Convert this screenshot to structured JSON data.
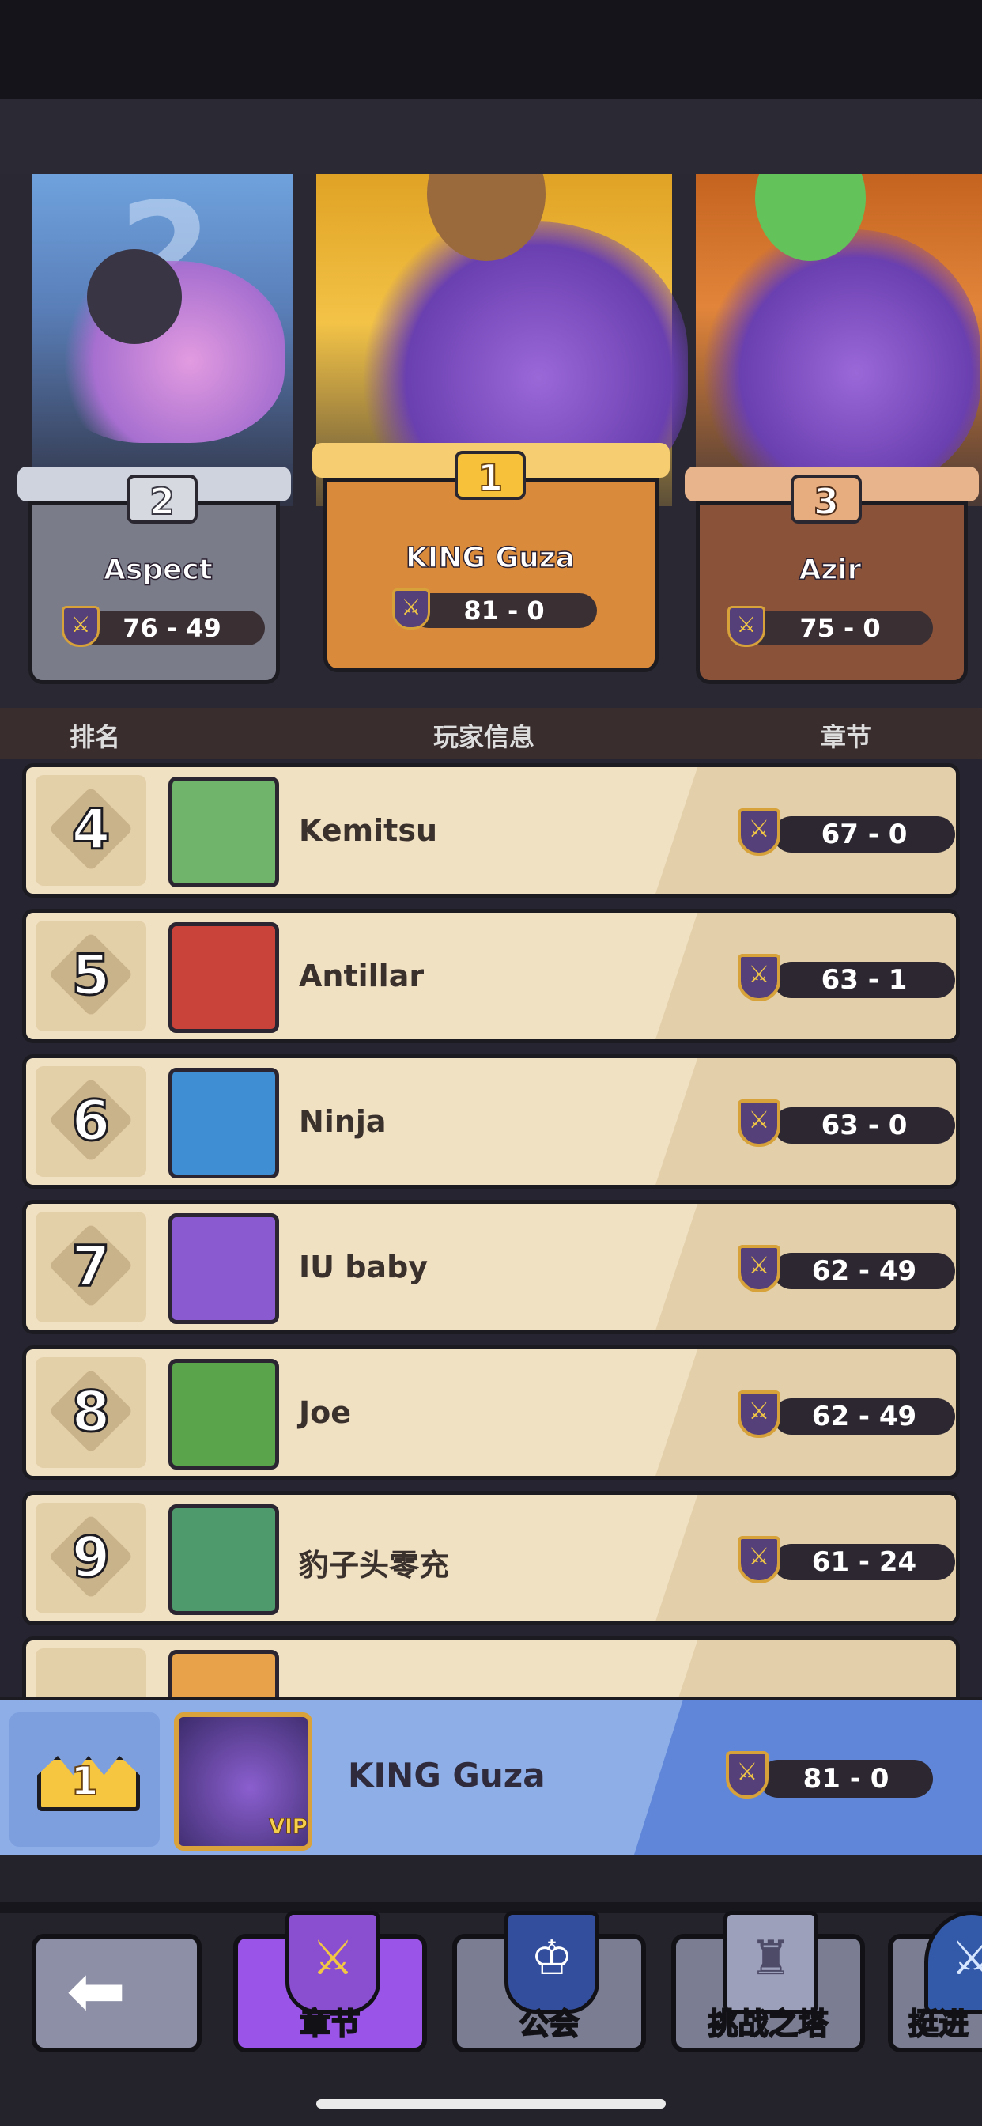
{
  "podium": {
    "first": {
      "rank": "1",
      "name": "KING Guza",
      "score": "81 - 0"
    },
    "second": {
      "rank": "2",
      "name": "Aspect",
      "score": "76 - 49",
      "bg_number": "2"
    },
    "third": {
      "rank": "3",
      "name": "Azir",
      "score": "75 - 0"
    }
  },
  "header": {
    "rank": "排名",
    "player_info": "玩家信息",
    "chapter": "章节"
  },
  "rows": [
    {
      "rank": "4",
      "name": "Kemitsu",
      "score": "67 - 0",
      "avatar_color": "#6fb46a"
    },
    {
      "rank": "5",
      "name": "Antillar",
      "score": "63 - 1",
      "avatar_color": "#c9433b"
    },
    {
      "rank": "6",
      "name": "Ninja",
      "score": "63 - 0",
      "avatar_color": "#3f8ed3"
    },
    {
      "rank": "7",
      "name": "IU baby",
      "score": "62 - 49",
      "avatar_color": "#8a5bd0"
    },
    {
      "rank": "8",
      "name": "Joe",
      "score": "62 - 49",
      "avatar_color": "#5aa54b"
    },
    {
      "rank": "9",
      "name": "豹子头零充",
      "score": "61 - 24",
      "avatar_color": "#4f9a6c"
    }
  ],
  "me": {
    "rank": "1",
    "name": "KING Guza",
    "score": "81 - 0",
    "vip": "VIP"
  },
  "nav": {
    "back_icon": "back-arrow-icon",
    "tabs": [
      {
        "label": "章节",
        "icon": "chapter-icon",
        "active": true
      },
      {
        "label": "公会",
        "icon": "guild-icon",
        "active": false
      },
      {
        "label": "挑战之塔",
        "icon": "tower-icon",
        "active": false
      },
      {
        "label": "挺进",
        "icon": "advance-icon",
        "active": false
      }
    ]
  },
  "colors": {
    "gold": "#f6c640",
    "silver": "#cfd3dd",
    "bronze": "#e7b48c",
    "active_tab": "#9a55e8",
    "my_bar": "#8eaee8"
  }
}
